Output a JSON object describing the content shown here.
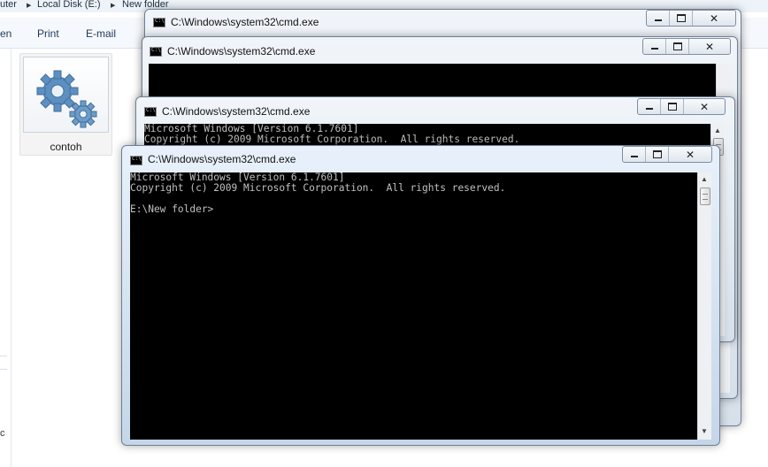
{
  "explorer": {
    "breadcrumb": [
      "uter",
      "Local Disk (E:)",
      "New folder"
    ],
    "toolbar": [
      "en",
      "Print",
      "E-mail"
    ],
    "file": {
      "name": "contoh",
      "icon": "gear-icon"
    },
    "nav_text": "c"
  },
  "windows": [
    {
      "title": "C:\\Windows\\system32\\cmd.exe",
      "lines": []
    },
    {
      "title": "C:\\Windows\\system32\\cmd.exe",
      "lines": []
    },
    {
      "title": "C:\\Windows\\system32\\cmd.exe",
      "lines": [
        "Microsoft Windows [Version 6.1.7601]",
        "Copyright (c) 2009 Microsoft Corporation.  All rights reserved."
      ]
    },
    {
      "title": "C:\\Windows\\system32\\cmd.exe",
      "lines": [
        "Microsoft Windows [Version 6.1.7601]",
        "Copyright (c) 2009 Microsoft Corporation.  All rights reserved.",
        "",
        "E:\\New folder>"
      ]
    }
  ],
  "controls": {
    "close_symbol": "✕"
  },
  "colors": {
    "console_bg": "#000000",
    "console_text": "#c0c0c0"
  }
}
